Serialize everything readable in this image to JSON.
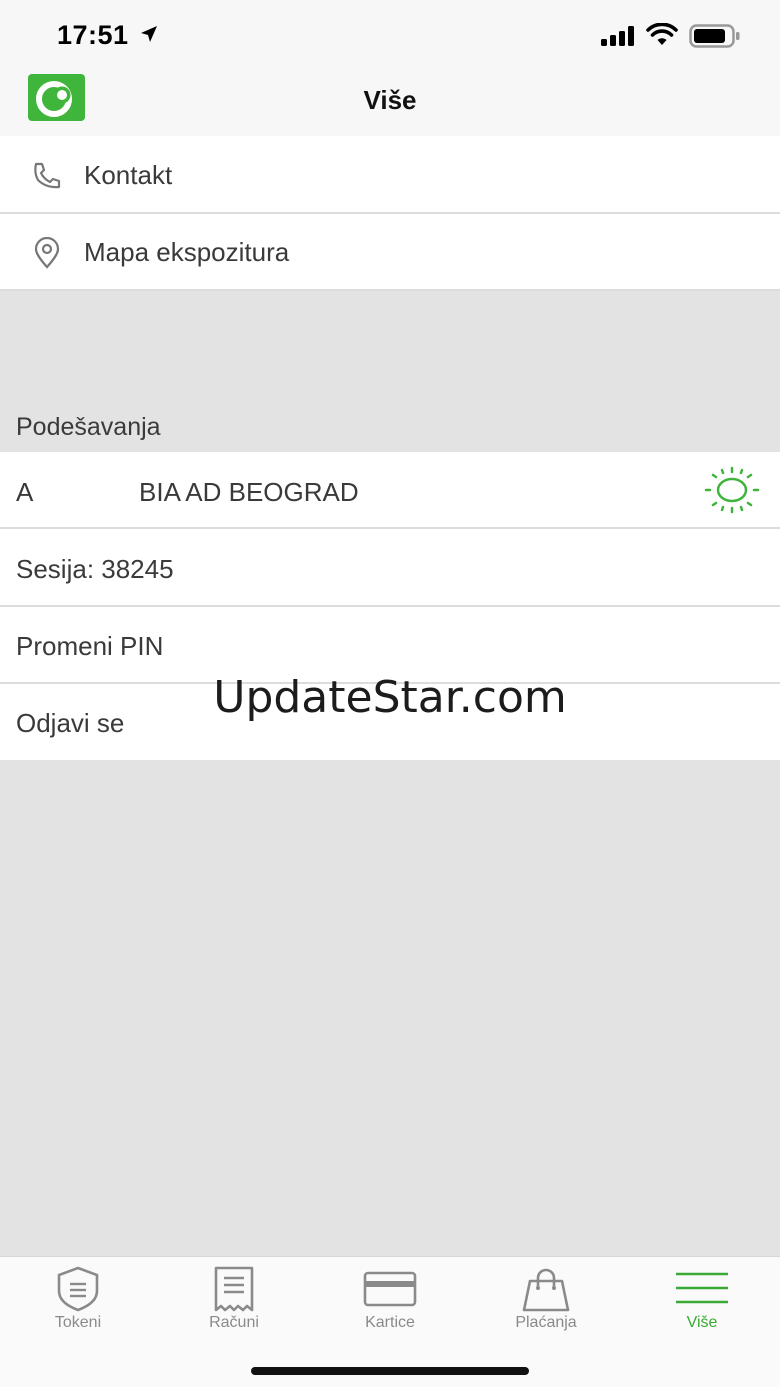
{
  "status_bar": {
    "time": "17:51"
  },
  "header": {
    "title": "Više",
    "logo_icon": "bank-logo-icon",
    "brand_color": "#3fb53b"
  },
  "menu": {
    "items": [
      {
        "label": "Kontakt",
        "icon": "phone-icon"
      },
      {
        "label": "Mapa ekspozitura",
        "icon": "location-pin-icon"
      }
    ]
  },
  "settings": {
    "section_title": "Podešavanja",
    "account_prefix": "A",
    "account_name": "BIA AD BEOGRAD",
    "session": "Sesija: 38245",
    "change_pin": "Promeni PIN",
    "logout": "Odjavi se"
  },
  "watermark": "UpdateStar.com",
  "tab_bar": {
    "accent_color": "#3aa935",
    "tabs": [
      {
        "label": "Tokeni",
        "icon": "shield-icon",
        "active": false
      },
      {
        "label": "Računi",
        "icon": "receipt-icon",
        "active": false
      },
      {
        "label": "Kartice",
        "icon": "card-icon",
        "active": false
      },
      {
        "label": "Plaćanja",
        "icon": "shopping-bag-icon",
        "active": false
      },
      {
        "label": "Više",
        "icon": "menu-icon",
        "active": true
      }
    ]
  }
}
